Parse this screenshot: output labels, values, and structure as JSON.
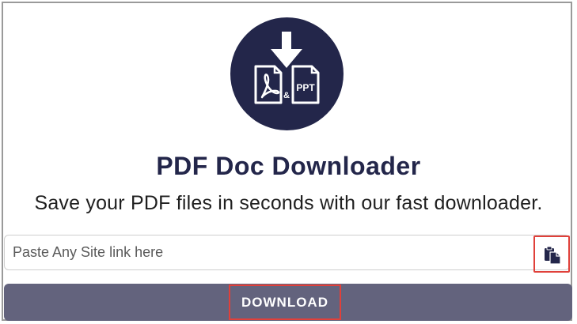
{
  "app": {
    "title": "PDF Doc Downloader",
    "subtitle": "Save your PDF files in seconds with our fast downloader."
  },
  "logo": {
    "icon": "pdf-ppt-download-icon",
    "ampersand": "&",
    "ppt_label": "PPT",
    "background_color": "#23264a"
  },
  "search": {
    "placeholder": "Paste Any Site link here",
    "value": "",
    "paste_icon": "clipboard-paste-icon"
  },
  "actions": {
    "download_label": "DOWNLOAD",
    "bar_color": "#63637d",
    "highlight_color": "#e0403a"
  }
}
